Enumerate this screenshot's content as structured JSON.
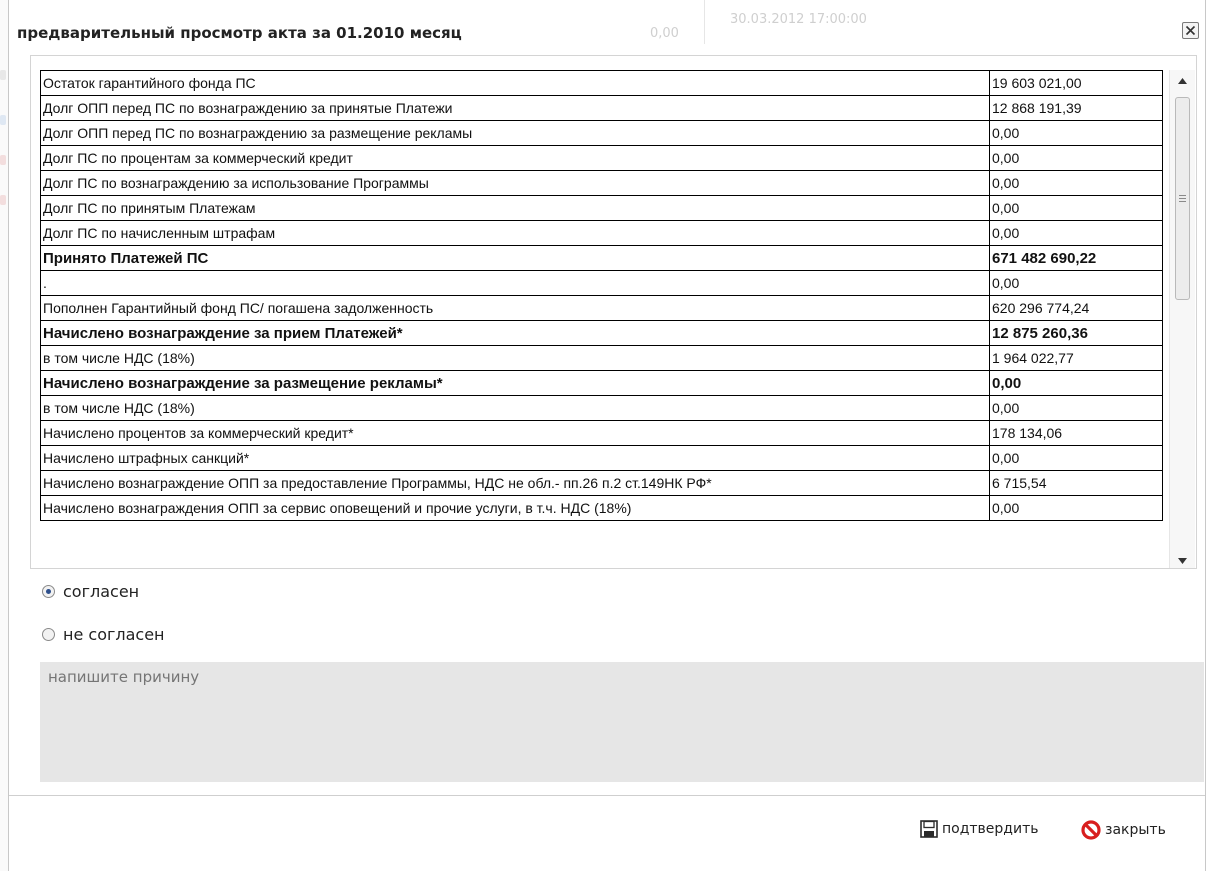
{
  "dialog": {
    "title": "предварительный просмотр акта за 01.2010 месяц"
  },
  "background": {
    "amount": "0,00",
    "datetime": "30.03.2012 17:00:00"
  },
  "table": {
    "rows": [
      {
        "label": "Остаток гарантийного фонда ПС",
        "value": "19 603 021,00",
        "bold": false
      },
      {
        "label": "Долг ОПП перед ПС по вознаграждению за принятые Платежи",
        "value": "12 868 191,39",
        "bold": false
      },
      {
        "label": "Долг ОПП перед ПС по вознаграждению за размещение рекламы",
        "value": "0,00",
        "bold": false
      },
      {
        "label": "Долг ПС по процентам за коммерческий кредит",
        "value": "0,00",
        "bold": false
      },
      {
        "label": "Долг ПС по вознаграждению за использование Программы",
        "value": "0,00",
        "bold": false
      },
      {
        "label": "Долг ПС по принятым Платежам",
        "value": "0,00",
        "bold": false
      },
      {
        "label": "Долг ПС по начисленным штрафам",
        "value": "0,00",
        "bold": false
      },
      {
        "label": "Принято Платежей ПС",
        "value": "671 482 690,22",
        "bold": true
      },
      {
        "label": ".",
        "value": "0,00",
        "bold": false
      },
      {
        "label": "Пополнен Гарантийный фонд ПС/ погашена задолженность",
        "value": "620 296 774,24",
        "bold": false
      },
      {
        "label": "Начислено вознаграждение за прием Платежей*",
        "value": "12 875 260,36",
        "bold": true
      },
      {
        "label": "в том числе НДС (18%)",
        "value": "1 964 022,77",
        "bold": false
      },
      {
        "label": "Начислено вознаграждение за размещение рекламы*",
        "value": "0,00",
        "bold": true
      },
      {
        "label": "в том числе НДС (18%)",
        "value": "0,00",
        "bold": false
      },
      {
        "label": "Начислено процентов за коммерческий кредит*",
        "value": "178 134,06",
        "bold": false
      },
      {
        "label": "Начислено штрафных санкций*",
        "value": "0,00",
        "bold": false
      },
      {
        "label": "Начислено вознаграждение ОПП за предоставление Программы, НДС не обл.- пп.26 п.2 ст.149НК РФ*",
        "value": "6 715,54",
        "bold": false
      },
      {
        "label": "Начислено вознаграждения ОПП за сервис оповещений и прочие услуги, в т.ч. НДС (18%)",
        "value": "0,00",
        "bold": false
      }
    ]
  },
  "choice": {
    "agree_label": "согласен",
    "disagree_label": "не согласен",
    "selected": "agree"
  },
  "reason": {
    "placeholder": "напишите причину",
    "value": ""
  },
  "footer": {
    "confirm_label": "подтвердить",
    "close_label": "закрыть"
  },
  "icons": {
    "close": "close-icon",
    "confirm": "floppy-disk-icon",
    "cancel": "no-entry-icon",
    "scroll_up": "arrow-up-icon",
    "scroll_down": "arrow-down-icon"
  },
  "colors": {
    "cancel_icon": "#d81e1e",
    "radio_selected": "#2d4f8c",
    "reason_bg": "#e6e6e6"
  }
}
